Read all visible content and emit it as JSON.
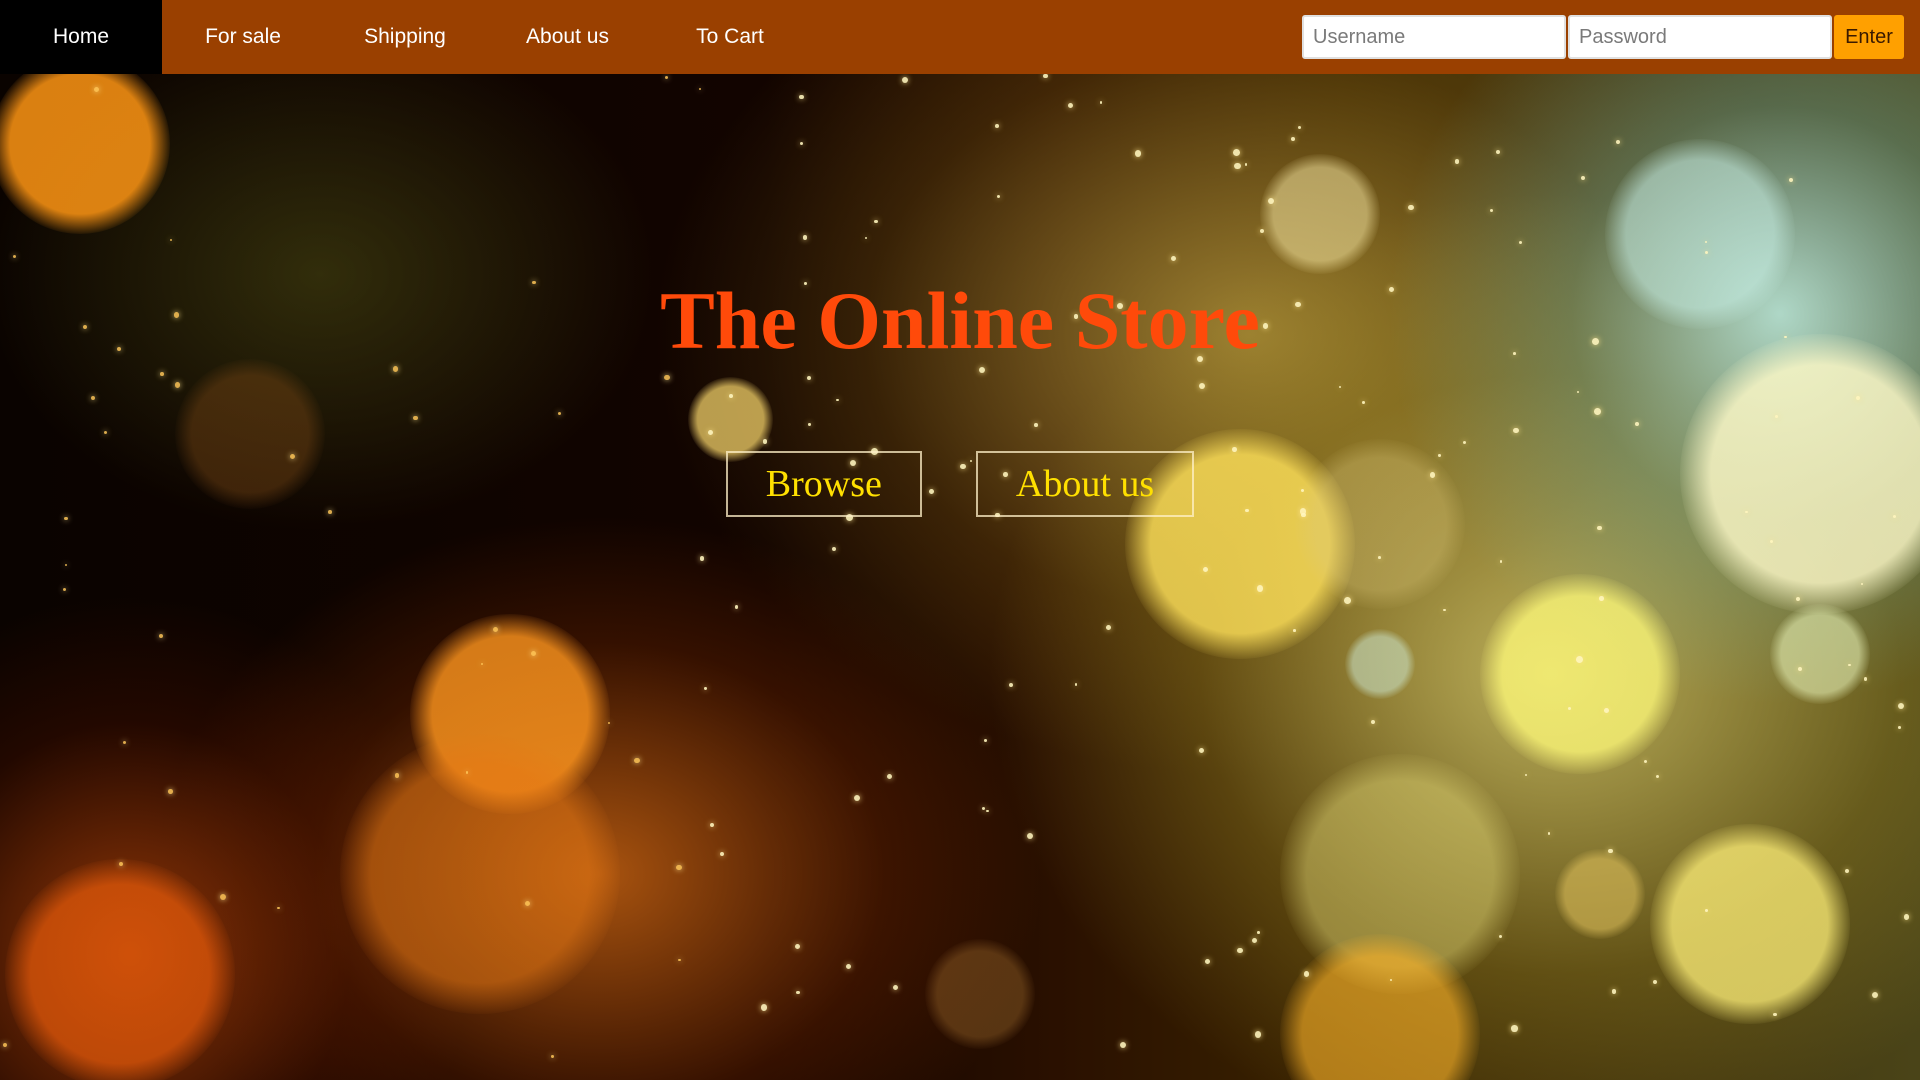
{
  "nav": {
    "items": [
      {
        "label": "Home",
        "active": true
      },
      {
        "label": "For sale",
        "active": false
      },
      {
        "label": "Shipping",
        "active": false
      },
      {
        "label": "About us",
        "active": false
      },
      {
        "label": "To Cart",
        "active": false
      }
    ]
  },
  "login": {
    "username_placeholder": "Username",
    "password_placeholder": "Password",
    "enter_label": "Enter"
  },
  "hero": {
    "title": "The Online Store",
    "buttons": {
      "browse_label": "Browse",
      "about_label": "About us"
    }
  },
  "colors": {
    "navbar_bg": "#9a4000",
    "nav_active_bg": "#000000",
    "enter_button_bg": "#ffa000",
    "title_color": "#ff4a0a",
    "hero_button_text": "#ffe000"
  }
}
